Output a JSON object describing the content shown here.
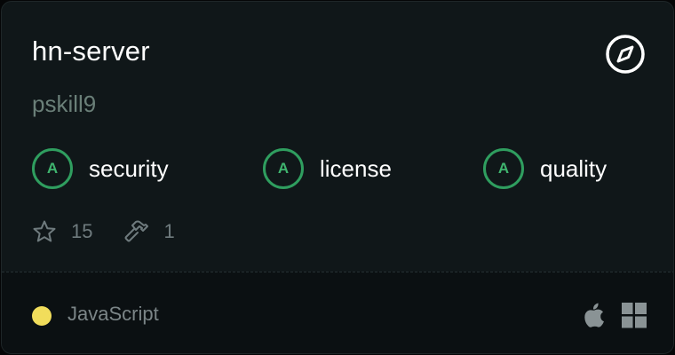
{
  "repo": {
    "name": "hn-server",
    "owner": "pskill9"
  },
  "icons": {
    "explore": "compass-icon",
    "stars": "star-icon",
    "tools": "hammer-icon",
    "platform_mac": "apple-icon",
    "platform_windows": "windows-icon"
  },
  "scores": [
    {
      "grade": "A",
      "label": "security"
    },
    {
      "grade": "A",
      "label": "license"
    },
    {
      "grade": "A",
      "label": "quality"
    }
  ],
  "stats": {
    "stars": "15",
    "tools": "1"
  },
  "footer": {
    "language": "JavaScript",
    "language_color": "#f1dd5b"
  },
  "colors": {
    "grade_accent": "#2f9e5f",
    "card_bg": "#101719"
  }
}
